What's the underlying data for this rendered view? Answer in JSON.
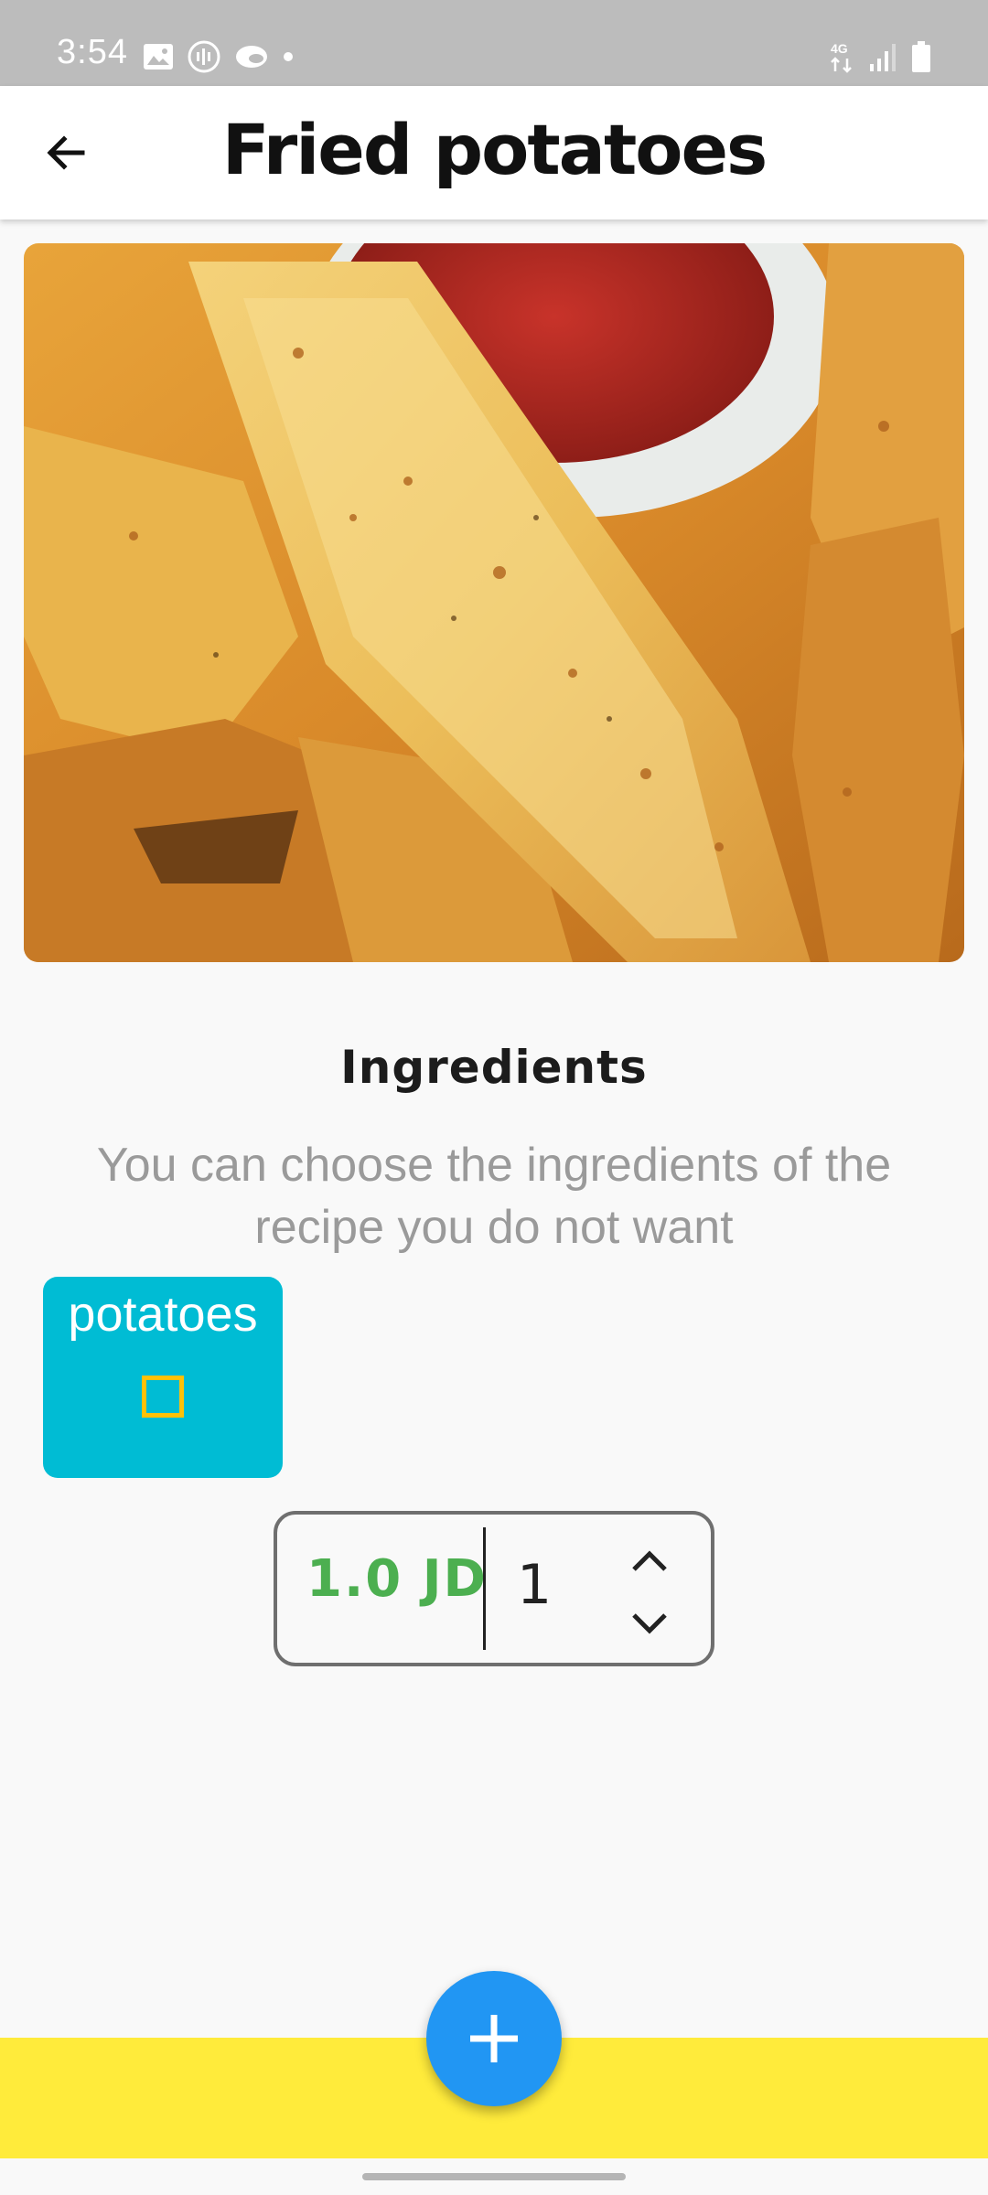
{
  "status_bar": {
    "time": "3:54",
    "left_icons": [
      "image-icon",
      "voice-recorder-icon",
      "cloud-icon",
      "dot-icon"
    ],
    "network_label": "4G",
    "right_icons": [
      "data-arrows-icon",
      "signal-icon",
      "battery-icon"
    ]
  },
  "app_bar": {
    "title": "Fried potatoes",
    "back_icon": "arrow-left-icon"
  },
  "photo": {
    "subject": "fried potato wedges with ketchup"
  },
  "ingredients": {
    "heading": "Ingredients",
    "description": "You can choose the ingredients of the recipe you do not want",
    "items": [
      {
        "name": "potatoes",
        "checked": false
      }
    ]
  },
  "order": {
    "price": "1.0 JD",
    "quantity": "1",
    "up_icon": "chevron-up-icon",
    "down_icon": "chevron-down-icon"
  },
  "fab": {
    "icon": "plus-icon"
  },
  "colors": {
    "status_bar": "#bcbcbc",
    "card": "#00bcd4",
    "checkbox": "#ffc107",
    "price": "#4caf50",
    "fab": "#2196f3",
    "bottom_bar": "#ffeb3b"
  }
}
